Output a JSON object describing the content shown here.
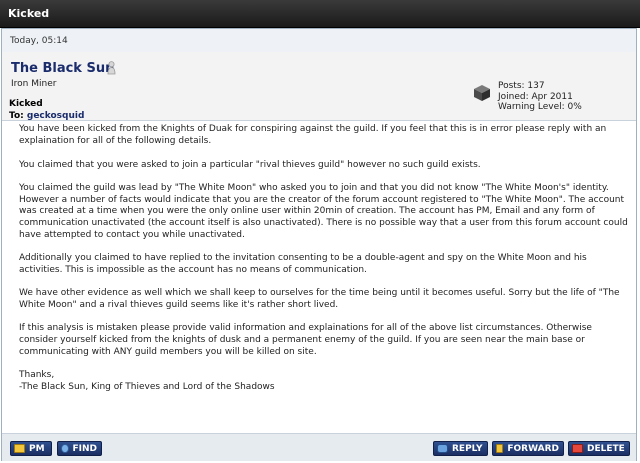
{
  "window": {
    "title": "Kicked"
  },
  "post": {
    "date": "Today, 05:14",
    "author": {
      "name": "The Black Sun",
      "rank": "Iron Miner",
      "posts": "Posts: 137",
      "joined": "Joined: Apr 2011",
      "warning": "Warning Level: 0%"
    },
    "message": {
      "title": "Kicked",
      "to_label": "To:",
      "to_name": "geckosquid",
      "paragraphs": [
        "You have been kicked from the Knights of Duak for conspiring against the guild. If you feel that this is in error please reply with an explaination for all of the following details.",
        "You claimed that you were asked to join a particular \"rival thieves guild\" however no such guild exists.",
        "You claimed the guild was lead by \"The White Moon\" who asked you to join and that you did not know \"The White Moon's\" identity. However a number of facts would indicate that you are the creator of the forum account registered to \"The White Moon\". The account was created at a time when you were the only online user within 20min of creation. The account has PM, Email and any form of communication unactivated (the account itself is also unactivated). There is no possible way that a user from this forum account could have attempted to contact you while unactivated.",
        "Additionally you claimed to have replied to the invitation consenting to be a double-agent and spy on the White Moon and his activities. This is impossible as the account has no means of communication.",
        "We have other evidence as well which we shall keep to ourselves for the time being until it becomes useful. Sorry but the life of \"The White Moon\" and a rival thieves guild seems like it's rather short lived.",
        "If this analysis is mistaken please provide valid information and explainations for all of the above list circumstances. Otherwise consider yourself kicked from the knights of dusk and a permanent enemy of the guild. If you are seen near the main base or communicating with ANY guild members you will be killed on site."
      ],
      "signoff": "Thanks,",
      "signature": "-The Black Sun, King of Thieves and Lord of the Shadows"
    }
  },
  "buttons": {
    "pm": "PM",
    "find": "FIND",
    "reply": "REPLY",
    "forward": "FORWARD",
    "delete": "DELETE"
  },
  "icons": {
    "status": "offline-status-icon",
    "avatar": "block-avatar-icon"
  },
  "colors": {
    "title_bar": "#1a1a1a",
    "username": "#1a2c6c",
    "button": "#1b2f63"
  }
}
